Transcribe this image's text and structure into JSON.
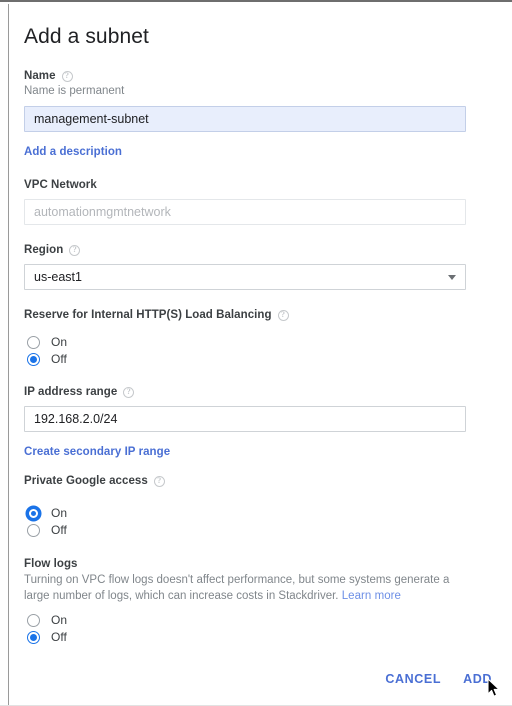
{
  "dialog": {
    "title": "Add a subnet"
  },
  "name_field": {
    "label": "Name",
    "help_icon": "help-circle-icon",
    "sub_label": "Name is permanent",
    "value": "management-subnet",
    "placeholder": ""
  },
  "add_description_link": {
    "label": "Add a description"
  },
  "vpc_network_field": {
    "label": "VPC Network",
    "value": "automationmgmtnetwork",
    "disabled": true
  },
  "region_field": {
    "label": "Region",
    "help_icon": "help-circle-icon",
    "selected": "us-east1",
    "dropdown_icon": "chevron-down-icon"
  },
  "reserve_ilb_field": {
    "label": "Reserve for Internal HTTP(S) Load Balancing",
    "help_icon": "help-circle-icon",
    "options": [
      "On",
      "Off"
    ],
    "selected": "Off"
  },
  "ip_range_field": {
    "label": "IP address range",
    "help_icon": "help-circle-icon",
    "value": "192.168.2.0/24"
  },
  "secondary_range_link": {
    "label": "Create secondary IP range"
  },
  "private_google_access_field": {
    "label": "Private Google access",
    "help_icon": "help-circle-icon",
    "options": [
      "On",
      "Off"
    ],
    "selected": "On"
  },
  "flow_logs_field": {
    "label": "Flow logs",
    "description": "Turning on VPC flow logs doesn't affect performance, but some systems generate a large number of logs, which can increase costs in Stackdriver.",
    "learn_more_label": "Learn more",
    "options": [
      "On",
      "Off"
    ],
    "selected": "Off"
  },
  "footer": {
    "cancel_label": "CANCEL",
    "add_label": "ADD"
  },
  "colors": {
    "accent_link": "#4a6fd4",
    "radio_selected": "#1a73e8",
    "focused_input_bg": "#e8eefc",
    "text_primary": "#202124",
    "text_secondary": "#80868b"
  }
}
